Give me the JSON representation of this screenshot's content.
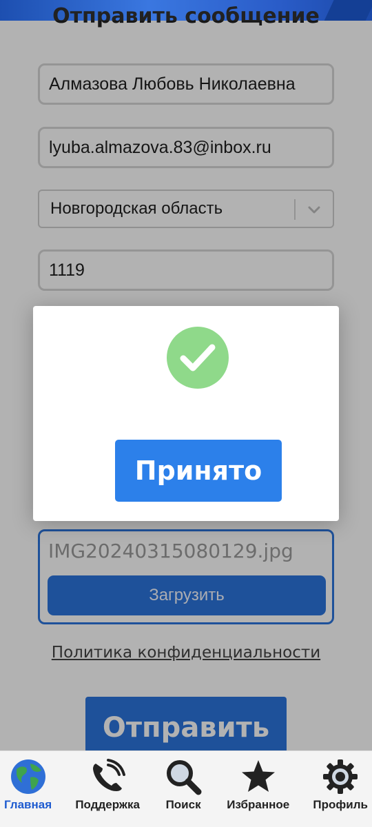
{
  "form": {
    "title": "Отправить сообщение",
    "name_value": "Алмазова Любовь Николаевна",
    "email_value": "lyuba.almazova.83@inbox.ru",
    "region_selected": "Новгородская область",
    "code_value": "1119",
    "file_name": "IMG20240315080129.jpg",
    "upload_label": "Загрузить",
    "privacy_label": "Политика конфиденциальности",
    "submit_label": "Отправить"
  },
  "modal": {
    "accept_label": "Принято",
    "check_color": "#8fd98a"
  },
  "nav": {
    "items": [
      {
        "label": "Главная",
        "icon": "globe-icon",
        "active": true
      },
      {
        "label": "Поддержка",
        "icon": "phone-icon",
        "active": false
      },
      {
        "label": "Поиск",
        "icon": "search-icon",
        "active": false
      },
      {
        "label": "Избранное",
        "icon": "star-icon",
        "active": false
      },
      {
        "label": "Профиль",
        "icon": "gear-icon",
        "active": false
      }
    ]
  },
  "colors": {
    "accent": "#2c74dd",
    "active_nav": "#1e5bd0"
  }
}
